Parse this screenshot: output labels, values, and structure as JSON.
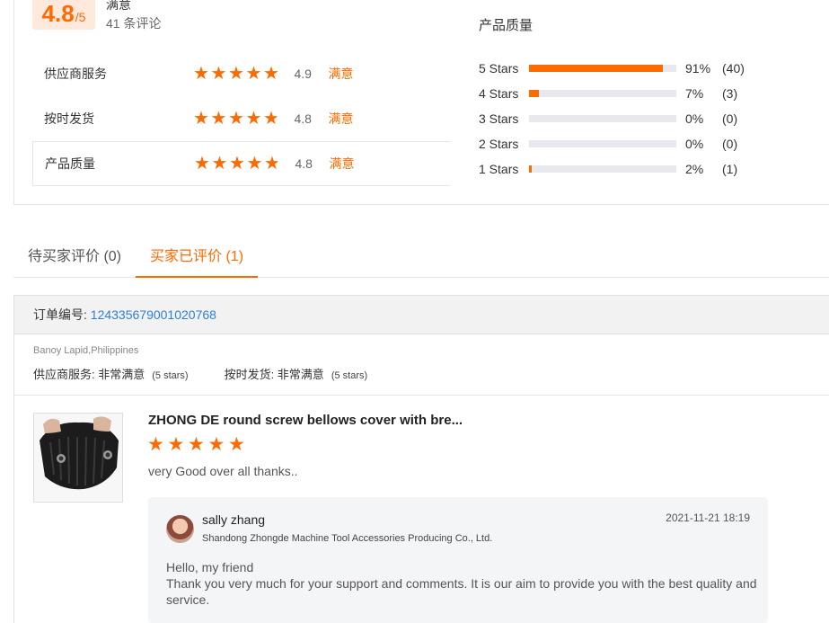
{
  "summary": {
    "score": "4.8",
    "score_max": "/5",
    "overall_word": "满意",
    "review_count": "41 条评论",
    "dimensions": [
      {
        "label": "供应商服务",
        "score": "4.9",
        "word": "满意",
        "rating": 4.9
      },
      {
        "label": "按时发货",
        "score": "4.8",
        "word": "满意",
        "rating": 4.8
      },
      {
        "label": "产品质量",
        "score": "4.8",
        "word": "满意",
        "rating": 4.8
      }
    ]
  },
  "distribution": {
    "title": "产品质量",
    "rows": [
      {
        "label": "5  Stars",
        "pct_text": "91%",
        "count": "(40)",
        "fraction": 0.91
      },
      {
        "label": "4  Stars",
        "pct_text": "7%",
        "count": "(3)",
        "fraction": 0.07
      },
      {
        "label": "3  Stars",
        "pct_text": "0%",
        "count": "(0)",
        "fraction": 0
      },
      {
        "label": "2  Stars",
        "pct_text": "0%",
        "count": "(0)",
        "fraction": 0
      },
      {
        "label": "1  Stars",
        "pct_text": "2%",
        "count": "(1)",
        "fraction": 0.02
      }
    ]
  },
  "tabs": [
    {
      "label": "待买家评价 (0)",
      "active": false
    },
    {
      "label": "买家已评价 (1)",
      "active": true
    }
  ],
  "order": {
    "order_label": "订单编号: ",
    "order_number": "124335679001020768",
    "buyer_location": "Banoy Lapid,Philippines",
    "ratings": [
      {
        "label": "供应商服务: 非常满意",
        "sub": "(5 stars)"
      },
      {
        "label": "按时发货: 非常满意",
        "sub": "(5 stars)"
      }
    ],
    "product_title": "ZHONG DE round screw bellows cover with bre...",
    "review_rating": 5,
    "review_text": "very Good over all thanks..",
    "reply": {
      "name": "sally zhang",
      "company": "Shandong Zhongde Machine Tool Accessories Producing Co., Ltd.",
      "date": "2021-11-21 18:19",
      "line1": "Hello, my friend",
      "line2": "Thank you very much for your support and comments. It is our aim to provide you with the best quality and service."
    }
  },
  "colors": {
    "accent": "#ff6a00",
    "link": "#2f7fd8"
  }
}
